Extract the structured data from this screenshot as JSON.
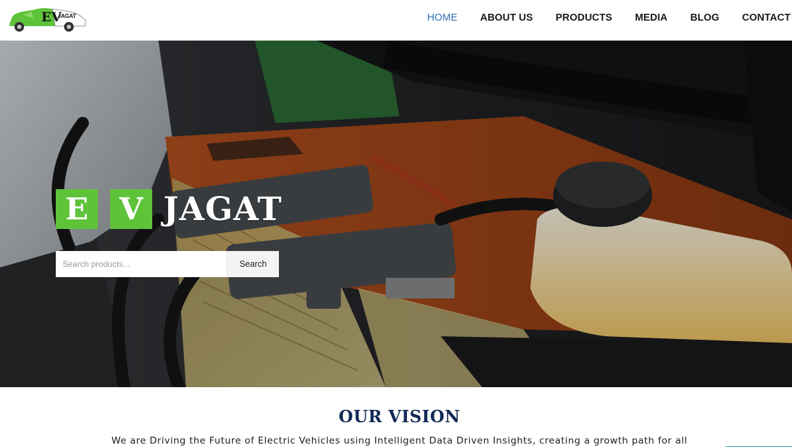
{
  "header": {
    "logo_text": "EV JAGAT",
    "nav": [
      {
        "label": "HOME",
        "active": true
      },
      {
        "label": "ABOUT US",
        "active": false
      },
      {
        "label": "PRODUCTS",
        "active": false
      },
      {
        "label": "MEDIA",
        "active": false
      },
      {
        "label": "BLOG",
        "active": false
      },
      {
        "label": "CONTACT",
        "active": false
      }
    ]
  },
  "hero": {
    "brand_letters": [
      "E",
      "V"
    ],
    "brand_word": "JAGAT",
    "search": {
      "placeholder": "Search products...",
      "value": "",
      "button_label": "Search"
    }
  },
  "vision": {
    "title": "OUR VISION",
    "text": "We are Driving the Future of Electric Vehicles using Intelligent Data Driven Insights, creating a growth path for all"
  },
  "colors": {
    "accent_green": "#5fc33a",
    "nav_active": "#2e6fb3",
    "heading_navy": "#0f2a55"
  }
}
